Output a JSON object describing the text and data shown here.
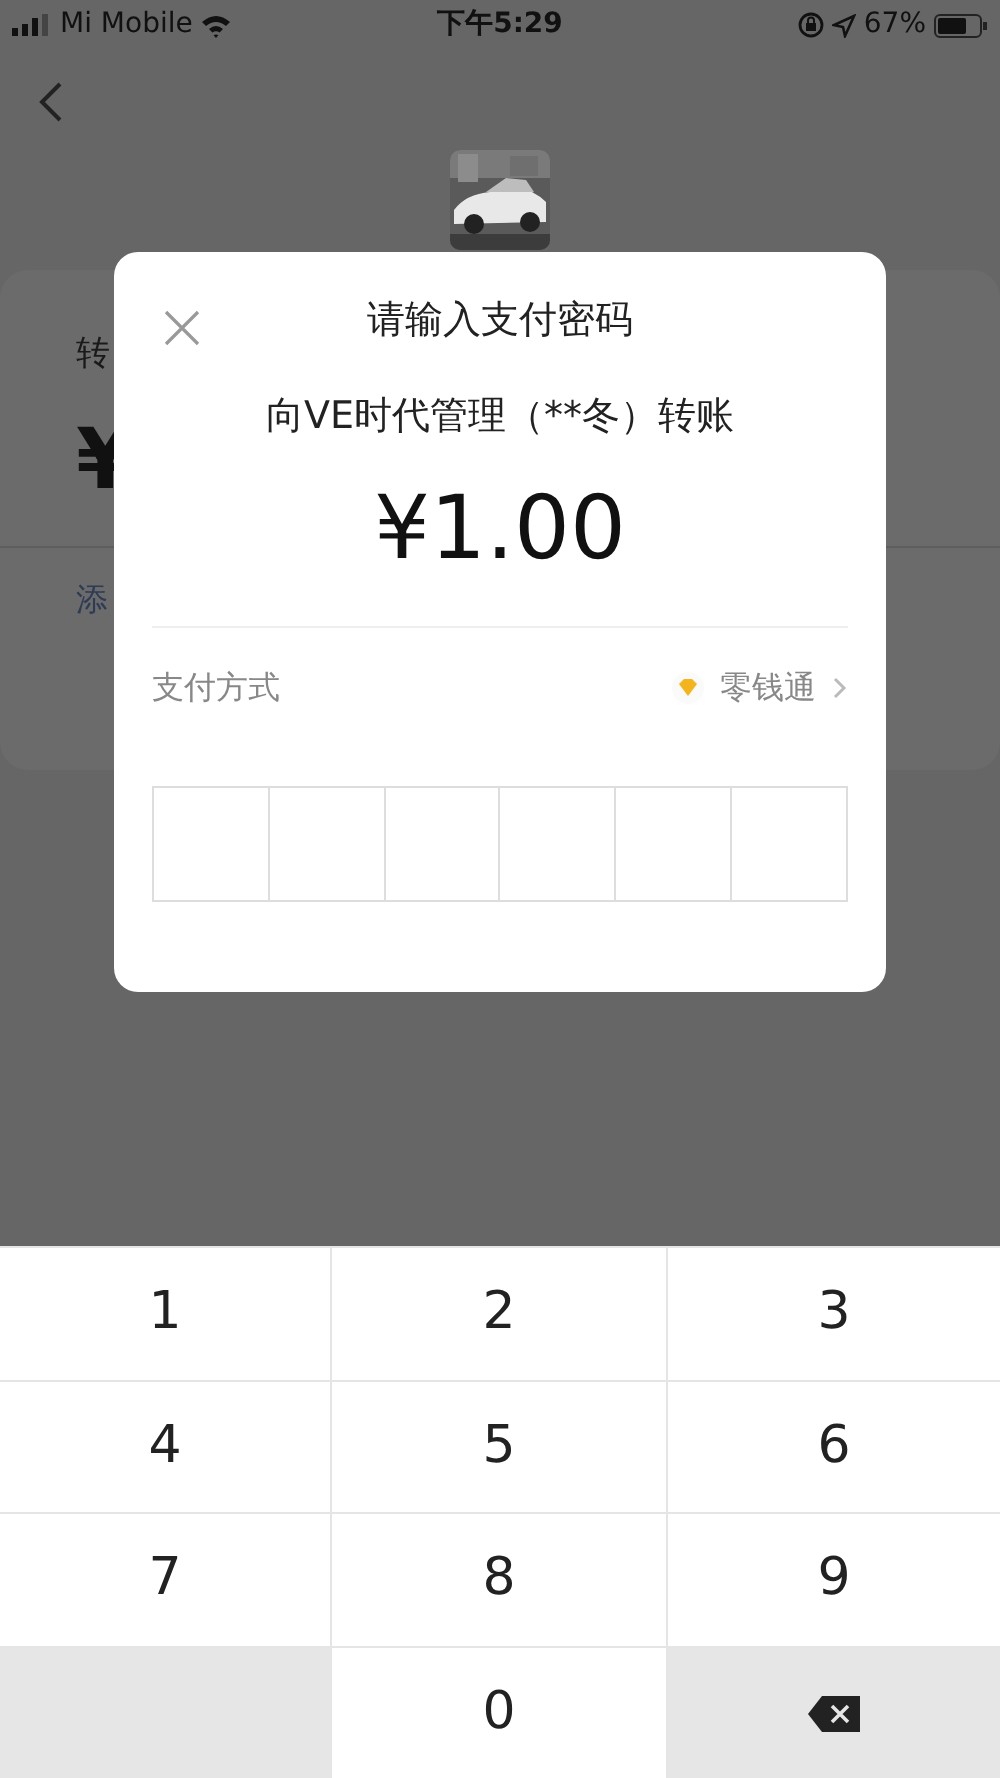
{
  "status_bar": {
    "carrier": "Mi Mobile",
    "time": "下午5:29",
    "battery": "67%"
  },
  "under_page": {
    "label": "转",
    "amount": "¥",
    "link": "添"
  },
  "dialog": {
    "title": "请输入支付密码",
    "payee": "向VE时代管理（**冬）转账",
    "amount": "¥1.00",
    "method_label": "支付方式",
    "method_value": "零钱通",
    "pin_slots": [
      {
        "filled": false
      },
      {
        "filled": false
      },
      {
        "filled": false
      },
      {
        "filled": false
      },
      {
        "filled": false
      },
      {
        "filled": false
      }
    ]
  },
  "keypad": [
    {
      "kind": "digit",
      "label": "1"
    },
    {
      "kind": "digit",
      "label": "2"
    },
    {
      "kind": "digit",
      "label": "3"
    },
    {
      "kind": "digit",
      "label": "4"
    },
    {
      "kind": "digit",
      "label": "5"
    },
    {
      "kind": "digit",
      "label": "6"
    },
    {
      "kind": "digit",
      "label": "7"
    },
    {
      "kind": "digit",
      "label": "8"
    },
    {
      "kind": "digit",
      "label": "9"
    },
    {
      "kind": "blank"
    },
    {
      "kind": "digit",
      "label": "0"
    },
    {
      "kind": "backspace"
    }
  ]
}
